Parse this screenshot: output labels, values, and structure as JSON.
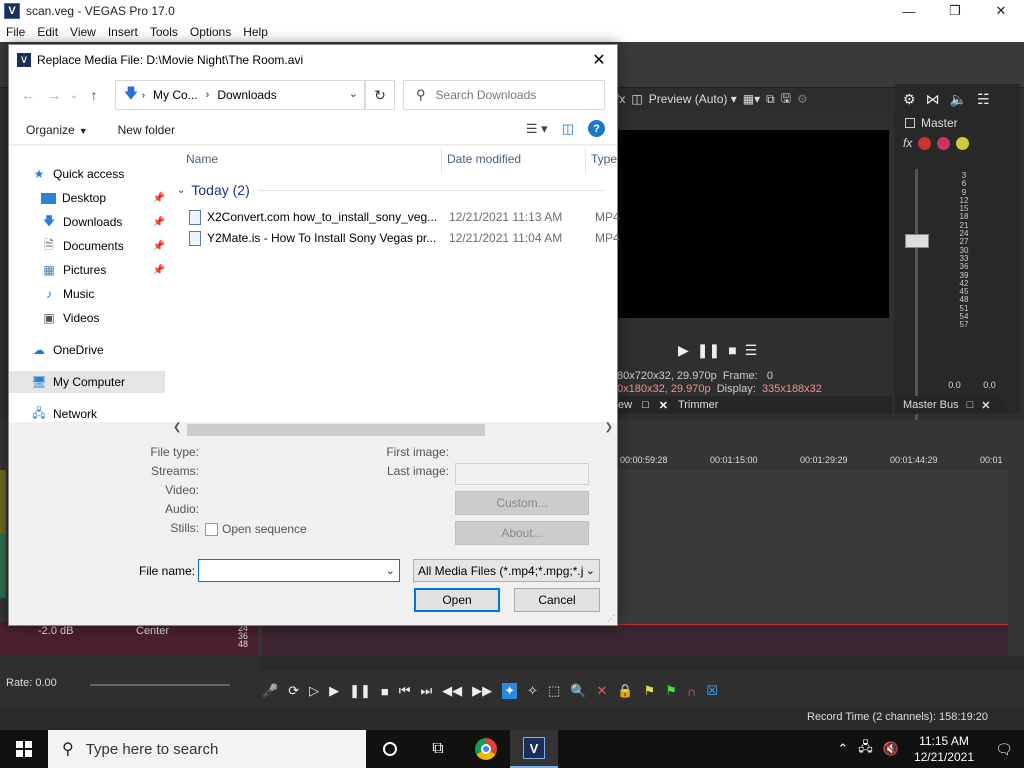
{
  "vegas": {
    "title": "scan.veg - VEGAS Pro 17.0",
    "logo": "V",
    "menu": [
      "File",
      "Edit",
      "View",
      "Insert",
      "Tools",
      "Options",
      "Help"
    ],
    "preview_mode": "Preview (Auto)",
    "preview_info": {
      "project": "80x720x32, 29.970p",
      "preview": "0x180x32, 29.970p",
      "frame_label": "Frame:",
      "frame_value": "0",
      "display_label": "Display:",
      "display_value": "335x188x32"
    },
    "tabs": [
      "ew",
      "Trimmer"
    ],
    "master": {
      "label": "Master",
      "bus_tab": "Master Bus",
      "meter_scale": [
        "3",
        "6",
        "9",
        "12",
        "15",
        "18",
        "21",
        "24",
        "27",
        "30",
        "33",
        "36",
        "39",
        "42",
        "45",
        "48",
        "51",
        "54",
        "57"
      ],
      "meter_left": "0.0",
      "meter_right": "0.0"
    },
    "ruler": [
      "00:00:59:28",
      "00:01:15:00",
      "00:01:29:29",
      "00:01:44:29",
      "00:01"
    ],
    "audio_track": {
      "volume": "-2.0 dB",
      "pan": "Center",
      "scale": [
        "24",
        "36",
        "48"
      ]
    },
    "rate": "Rate: 0.00",
    "record_time": "Record Time (2 channels): 158:19:20"
  },
  "dialog": {
    "title": "Replace Media File: D:\\Movie Night\\The Room.avi",
    "logo": "V",
    "address_crumbs": [
      "My Co...",
      "Downloads"
    ],
    "search_placeholder": "Search Downloads",
    "organize": "Organize",
    "new_folder": "New folder",
    "nav": {
      "quick_access": "Quick access",
      "items": [
        "Desktop",
        "Downloads",
        "Documents",
        "Pictures",
        "Music",
        "Videos"
      ],
      "onedrive": "OneDrive",
      "my_computer": "My Computer",
      "network": "Network"
    },
    "columns": {
      "name": "Name",
      "date": "Date modified",
      "type": "Type"
    },
    "group": "Today (2)",
    "files": [
      {
        "name": "X2Convert.com how_to_install_sony_veg...",
        "date": "12/21/2021 11:13 AM",
        "type": "MP4"
      },
      {
        "name": "Y2Mate.is - How To Install Sony Vegas pr...",
        "date": "12/21/2021 11:04 AM",
        "type": "MP4"
      }
    ],
    "info": {
      "file_type": "File type:",
      "streams": "Streams:",
      "video": "Video:",
      "audio": "Audio:",
      "stills": "Stills:",
      "open_sequence": "Open sequence",
      "first_image": "First image:",
      "last_image": "Last image:",
      "custom": "Custom...",
      "about": "About..."
    },
    "file_name_label": "File name:",
    "file_name_value": "",
    "filter": "All Media Files (*.mp4;*.mpg;*.j",
    "open": "Open",
    "cancel": "Cancel"
  },
  "taskbar": {
    "search_placeholder": "Type here to search",
    "time": "11:15 AM",
    "date": "12/21/2021"
  }
}
